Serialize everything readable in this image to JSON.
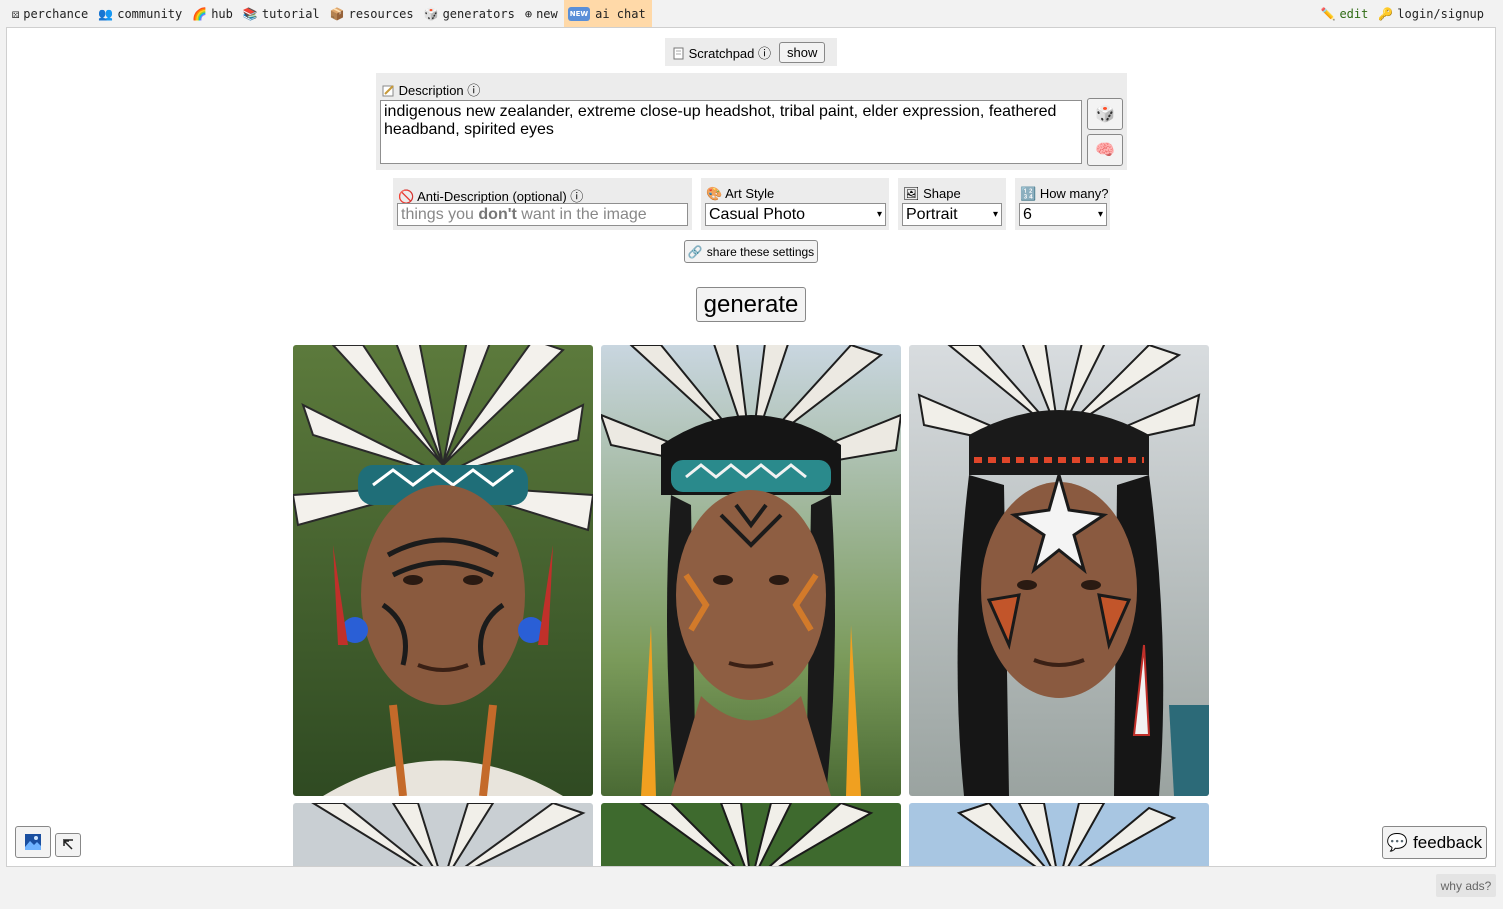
{
  "nav": {
    "left": [
      {
        "icon": "dice-icon",
        "glyph": "⚄",
        "label": "perchance"
      },
      {
        "icon": "people-icon",
        "glyph": "👥",
        "label": "community"
      },
      {
        "icon": "rainbow-icon",
        "glyph": "🌈",
        "label": "hub"
      },
      {
        "icon": "books-icon",
        "glyph": "📚",
        "label": "tutorial"
      },
      {
        "icon": "package-icon",
        "glyph": "📦",
        "label": "resources"
      },
      {
        "icon": "dice-icon",
        "glyph": "🎲",
        "label": "generators"
      },
      {
        "icon": "plus-circle-icon",
        "glyph": "⊕",
        "label": "new"
      },
      {
        "icon": "new-badge-icon",
        "glyph": "NEW",
        "label": "ai chat"
      }
    ],
    "right": [
      {
        "icon": "pencil-icon",
        "glyph": "✏️",
        "label": "edit"
      },
      {
        "icon": "key-icon",
        "glyph": "🔑",
        "label": "login/signup"
      }
    ]
  },
  "scratchpad": {
    "label": "Scratchpad ⓘ",
    "button": "show"
  },
  "description": {
    "label": "Description ⓘ",
    "value": "indigenous new zealander, extreme close-up headshot, tribal paint, elder expression, feathered headband, spirited eyes",
    "dice_glyph": "🎲",
    "brain_glyph": "🧠"
  },
  "anti_description": {
    "label": "Anti-Description (optional) ⓘ",
    "placeholder_pre": "things you ",
    "placeholder_bold": "don't",
    "placeholder_post": " want in the image"
  },
  "art_style": {
    "label": "Art Style",
    "value": "Casual Photo"
  },
  "shape": {
    "label": "Shape",
    "value": "Portrait"
  },
  "how_many": {
    "label": "How many?",
    "value": "6"
  },
  "share_button": "share these settings",
  "generate_button": "generate",
  "feedback_button": "feedback",
  "why_ads": "why ads?",
  "colors": {
    "accent_nav": "#ffd9a8",
    "panel": "#ececec"
  }
}
